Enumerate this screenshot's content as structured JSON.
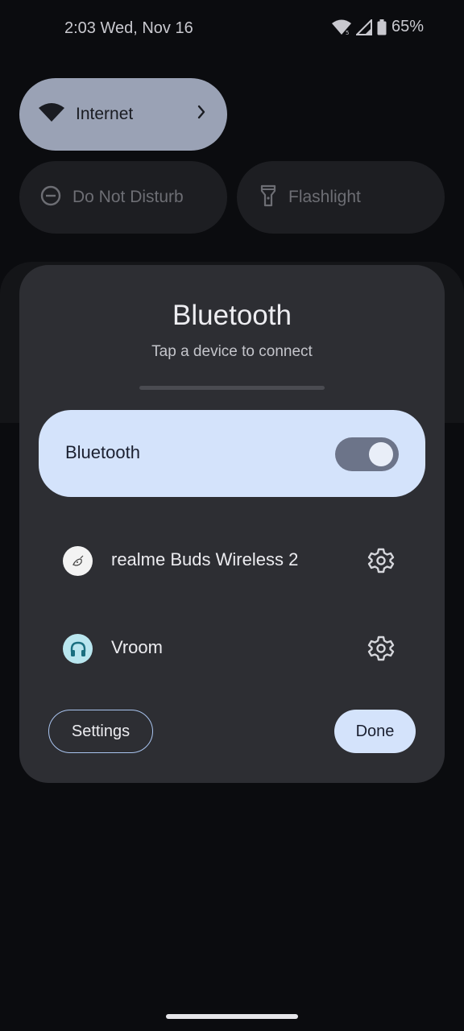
{
  "status_bar": {
    "time_date": "2:03 Wed, Nov 16",
    "battery": "65%",
    "icons": [
      "wifi-icon",
      "signal-icon",
      "battery-icon"
    ]
  },
  "quick_settings": {
    "tiles": [
      {
        "label": "Internet",
        "icon": "wifi-icon",
        "state": "on"
      },
      {
        "label": "Do Not Disturb",
        "icon": "do-not-disturb-icon",
        "state": "off"
      },
      {
        "label": "Flashlight",
        "icon": "flashlight-icon",
        "state": "off"
      }
    ]
  },
  "dialog": {
    "title": "Bluetooth",
    "subtitle": "Tap a device to connect",
    "toggle": {
      "label": "Bluetooth",
      "on": true
    },
    "devices": [
      {
        "name": "realme Buds Wireless 2",
        "icon": "earbuds-avatar-icon",
        "settings_icon": "gear-icon"
      },
      {
        "name": "Vroom",
        "icon": "headphones-icon",
        "settings_icon": "gear-icon"
      }
    ],
    "buttons": {
      "settings": "Settings",
      "done": "Done"
    }
  },
  "colors": {
    "background": "#0b0c0f",
    "dialog": "#2d2e33",
    "accent": "#d4e3fb",
    "tile_active": "#9aa2b5"
  }
}
